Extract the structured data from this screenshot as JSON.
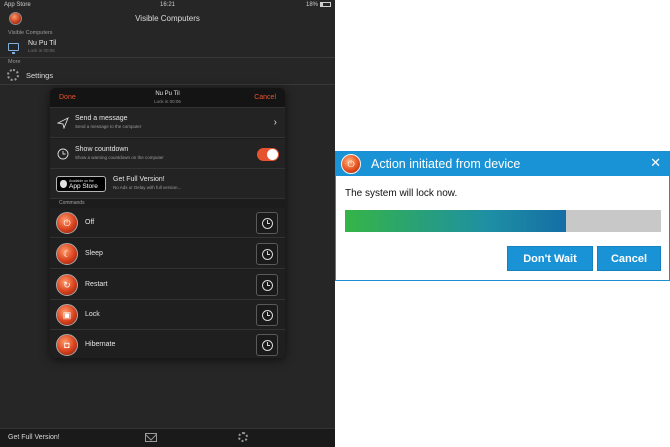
{
  "statusbar": {
    "carrier": "App Store",
    "time": "16:21",
    "battery": "18%"
  },
  "nav": {
    "title": "Visible Computers"
  },
  "sections": {
    "visible": "Visible Computers",
    "more": "More"
  },
  "computer": {
    "name": "Nu Pu Til",
    "sub": "Lock in 00:06"
  },
  "settings": {
    "label": "Settings"
  },
  "popup": {
    "done": "Done",
    "cancel": "Cancel",
    "title": "Nu Pu Til",
    "subtitle": "Lock in 00:06",
    "send_message": {
      "title": "Send a message",
      "sub": "Send a message to the computer"
    },
    "countdown": {
      "title": "Show countdown",
      "sub": "Show a warning countdown on the computer",
      "enabled": true
    },
    "full_version": {
      "badge_small": "Available on the",
      "badge_big": "App Store",
      "title": "Get Full Version!",
      "sub": "No Ads or Delay with full version..."
    },
    "commands_label": "Commands",
    "commands": [
      {
        "label": "Off",
        "icon": "power-icon"
      },
      {
        "label": "Sleep",
        "icon": "moon-icon"
      },
      {
        "label": "Restart",
        "icon": "restart-icon"
      },
      {
        "label": "Lock",
        "icon": "lock-icon"
      },
      {
        "label": "Hibernate",
        "icon": "hibernate-icon"
      }
    ]
  },
  "bottombar": {
    "get_full": "Get Full Version!"
  },
  "dialog": {
    "title": "Action initiated from device",
    "message": "The system will lock now.",
    "progress": 0.7,
    "dont_wait": "Don't Wait",
    "cancel": "Cancel",
    "accent": "#1a93d6"
  }
}
